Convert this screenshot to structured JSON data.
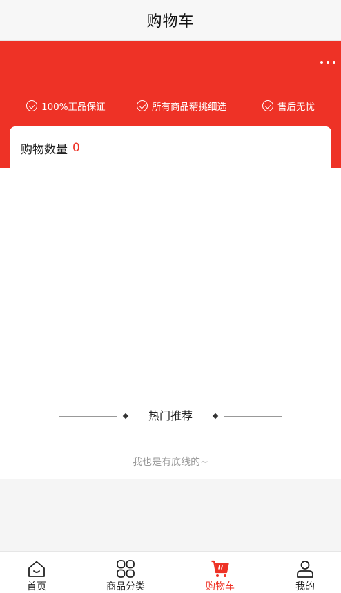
{
  "navbar": {
    "title": "购物车"
  },
  "header": {
    "guarantees": [
      "100%正品保证",
      "所有商品精挑细选",
      "售后无忧"
    ]
  },
  "cart": {
    "label": "购物数量",
    "count": "0"
  },
  "recommend": {
    "title": "热门推荐",
    "bottom_text": "我也是有底线的~"
  },
  "tabbar": {
    "items": [
      {
        "label": "首页",
        "icon": "home-icon"
      },
      {
        "label": "商品分类",
        "icon": "category-grid-icon"
      },
      {
        "label": "购物车",
        "icon": "cart-icon",
        "active": true
      },
      {
        "label": "我的",
        "icon": "user-icon"
      }
    ]
  },
  "colors": {
    "accent": "#ee3226",
    "text": "#222222",
    "muted": "#999999"
  }
}
